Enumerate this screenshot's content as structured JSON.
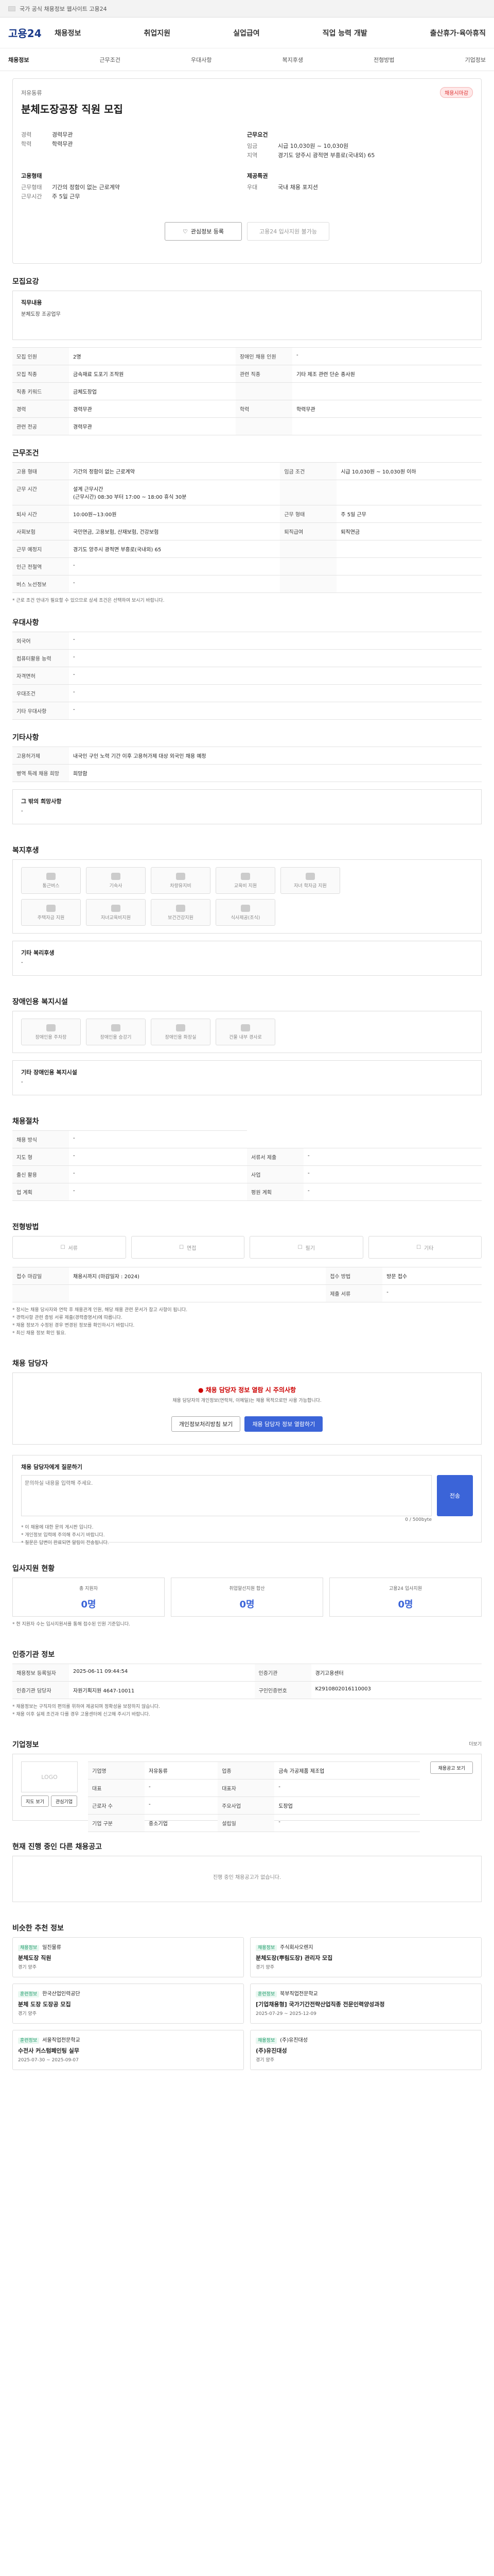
{
  "top": {
    "text": "국가 공식 채용정보 웹사이트 고용24"
  },
  "header": {
    "logo": "고용24",
    "gnb": [
      "채용정보",
      "취업지원",
      "실업급여",
      "직업 능력 개발",
      "출산휴가·육아휴직"
    ]
  },
  "sub": {
    "home": "채용정보",
    "items": [
      "근무조건",
      "우대사항",
      "복지후생",
      "전형방법",
      "기업정보"
    ]
  },
  "job": {
    "company_label": "저유동류",
    "title": "분체도장공장 직원 모집",
    "badge": "채용시마감",
    "left": [
      {
        "k": "경력",
        "v": "경력무관"
      },
      {
        "k": "학력",
        "v": "학력무관"
      }
    ],
    "right_label": "근무요건",
    "right": [
      {
        "k": "임금",
        "v": "시급 10,030원 ~ 10,030원"
      },
      {
        "k": "지역",
        "v": "경기도 양주시 광적면 부흥로(국내외) 65"
      }
    ],
    "etc_left_label": "고용형태",
    "etc_left": [
      {
        "k": "근무형태",
        "v": "기간의 정함이 없는 근로계약"
      },
      {
        "k": "근무시간",
        "v": "주 5일 근무"
      }
    ],
    "etc_right_label": "제공특권",
    "etc_right": [
      {
        "k": "우대",
        "v": "국내 채용 포지션"
      }
    ],
    "btn_save": "관심정보 등록",
    "btn_apply": "고용24 입사지원 불가능"
  },
  "section_summary": {
    "title": "모집요강",
    "label": "직무내용",
    "content": "분체도장 조공업무"
  },
  "recruit": {
    "rows": [
      [
        "모집 인원",
        "2명",
        "장애인 채용 인원",
        "-"
      ],
      [
        "모집 직종",
        "금속재료 도포기 조작원",
        "관련 직종",
        "기타 제조 관련 단순 종사원"
      ],
      [
        "직종 키워드",
        "금체도장업",
        "",
        ""
      ],
      [
        "경력",
        "경력무관",
        "학력",
        "학력무관"
      ],
      [
        "관련 전공",
        "경력무관",
        "",
        ""
      ]
    ]
  },
  "cond": {
    "title": "근무조건",
    "rows": [
      [
        "고용 형태",
        "기간의 정함이 없는 근로계약",
        "임금 조건",
        "시급 10,030원 ~ 10,030원 이하"
      ],
      [
        "근무 시간",
        "설계 근무시간\n(근무시간) 08:30 부터 17:00 ~ 18:00 휴식 30분",
        ""
      ],
      [
        "퇴사 시간",
        "10:00원~13:00원",
        "근무 형태",
        "주 5일 근무"
      ],
      [
        "사회보험",
        "국민연금, 고용보험, 산재보험, 건강보험",
        "퇴직급여",
        "퇴직연금"
      ],
      [
        "근무 예정지",
        "경기도 양주시 광적면 부흥로(국내외) 65",
        "",
        ""
      ],
      [
        "인근 전철역",
        "-",
        "",
        ""
      ],
      [
        "버스 노선정보",
        "-",
        "",
        ""
      ]
    ],
    "note": "* 근로 조건 안내가 필요할 수 있으므로 상세 조건은 선택하여 보시기 바랍니다."
  },
  "pref": {
    "title": "우대사항",
    "rows": [
      [
        "외국어",
        "-"
      ],
      [
        "컴퓨터활용 능력",
        "-"
      ],
      [
        "자격면허",
        "-"
      ],
      [
        "우대조건",
        "-"
      ],
      [
        "기타 우대사항",
        "-"
      ]
    ]
  },
  "etc": {
    "title": "기타사항",
    "rows": [
      [
        "고용허가제",
        "내국인 구인 노력 기간 이후 고용허가제 대상 외국인 채용 예정"
      ],
      [
        "병역 특례 채용 희망",
        "희망함"
      ]
    ],
    "extra_label": "그 밖의 희망사항",
    "extra": "-"
  },
  "welfare": {
    "title": "복지후생",
    "tiles": [
      "통근버스",
      "기숙사",
      "차량유지비",
      "교육비 지원",
      "자녀 학자금 지원",
      "주택자금 지원",
      "자녀교육비지원",
      "보건건강지원",
      "식사제공(조식)"
    ],
    "box_label": "기타 복리후생",
    "box": "-"
  },
  "disab": {
    "title": "장애인용 복지시설",
    "tiles": [
      "장애인용 주차장",
      "장애인용 승강기",
      "장애인용 화장실",
      "건물 내부 경사로"
    ],
    "box_label": "기타 장애인용 복지시설",
    "box": "-"
  },
  "hr": {
    "title": "채용절차",
    "rows": [
      [
        "채용 방식",
        "-"
      ],
      [
        "지도 형",
        "-",
        "서류서 제출",
        "-"
      ],
      [
        "출신 활용",
        "-",
        "사업",
        "-"
      ],
      [
        "업 계획",
        "-",
        "평원 계획",
        "-"
      ]
    ]
  },
  "screen": {
    "title": "전형방법",
    "buttons": [
      "서류",
      "면접",
      "필기",
      "기타"
    ],
    "rows": [
      [
        "접수 마감일",
        "채용시까지 (마감일자 : 2024)",
        "접수 방법",
        "방문 접수"
      ],
      [
        "",
        "",
        "제출 서류",
        "-"
      ]
    ],
    "notes": [
      "* 장시는 채용 당사자와 연락 후 채용관계 인원, 해당 채용 관련 문서가 참고 사항이 됩니다.",
      "* 경력사항 관련 증빙 서류 제출(경력증명서)에 따릅니다.",
      "* 채용 정보가 수정된 경우 변경된 정보를 확인하시기 바랍니다.",
      "* 최신 채용 정보 확인 필요."
    ]
  },
  "contact": {
    "title": "채용 담당자",
    "warn": "채용 담당자 정보 열람 시 주의사항",
    "warn_text": "채용 담당자의 개인정보(연락처, 이메일)는 채용 목적으로만 사용 가능합니다.",
    "btn_a": "개인정보처리방침 보기",
    "btn_b": "채용 담당자 정보 열람하기"
  },
  "inquiry": {
    "title": "채용 담당자에게 질문하기",
    "placeholder": "문의하실 내용을 입력해 주세요.",
    "count": "0 / 500byte",
    "btn": "전송",
    "notes": [
      "* 이 채용에 대한 문의 게시판 입니다.",
      "* 개인정보 입력에 주의해 주시기 바랍니다.",
      "* 질문은 답변이 완료되면 알림이 전송됩니다."
    ]
  },
  "status": {
    "title": "입사지원 현황",
    "cards": [
      {
        "label": "총 지원자",
        "value": "0명"
      },
      {
        "label": "취업알선지원 합산",
        "value": "0명"
      },
      {
        "label": "고용24 입사지원",
        "value": "0명"
      }
    ],
    "note": "* 현 지원자 수는 입사지원서를 통해 접수된 인원 기준입니다."
  },
  "auth": {
    "title": "인증기관 정보",
    "rows": [
      [
        "채용정보 등록일자",
        "2025-06-11 09:44:54",
        "인증기관",
        "경기고용센터"
      ],
      [
        "인증기관 담당자",
        "자원기획지원 4647-10011",
        "구인인증번호",
        "K2910802016110003"
      ]
    ],
    "notes": [
      "* 채용정보는 구직자의 편의를 위하여 제공되며 정확성을 보장하지 않습니다.",
      "* 채용 이후 실제 조건과 다를 경우 고용센터에 신고해 주시기 바랍니다."
    ]
  },
  "company": {
    "title": "기업정보",
    "more": "더보기",
    "logo": "LOGO",
    "btn_map": "지도 보기",
    "btn_fav": "관심기업",
    "rows": [
      [
        "기업명",
        "저유동류",
        "업종",
        "금속 가공제품 제조업"
      ],
      [
        "대표",
        "-",
        "대표자",
        "-"
      ],
      [
        "근로자 수",
        "-",
        "주요사업",
        "도장업"
      ],
      [
        "기업 구분",
        "중소기업",
        "설립일",
        "-"
      ]
    ],
    "btn_more": "채용공고 보기"
  },
  "others": {
    "title": "현재 진행 중인 다른 채용공고",
    "empty": "진행 중인 채용공고가 없습니다."
  },
  "rec": {
    "title": "비슷한 추천 정보",
    "items": [
      {
        "tag": "채용정보",
        "company": "일진물류",
        "title": "분체도장 직원",
        "meta": "경기 양주"
      },
      {
        "tag": "채용정보",
        "company": "주식회사오렌지",
        "title": "분체도장(뿌림도장) 관리자 모집",
        "meta": "경기 양주"
      },
      {
        "tag": "훈련정보",
        "company": "한국산업인력공단",
        "title": "분체 도장 도장공 모집",
        "meta": "경기 양주"
      },
      {
        "tag": "훈련정보",
        "company": "북부직업전문학교",
        "title": "[기업채용형] 국가기간전략산업직종 전문인력양성과정",
        "meta": "2025-07-29 ~ 2025-12-09"
      },
      {
        "tag": "훈련정보",
        "company": "서울직업전문학교",
        "title": "수전사 커스텀페인팅 실무",
        "meta": "2025-07-30 ~ 2025-09-07"
      },
      {
        "tag": "채용정보",
        "company": "(주)유진대성",
        "title": "(주)유진대성",
        "meta": "경기 양주"
      }
    ]
  }
}
